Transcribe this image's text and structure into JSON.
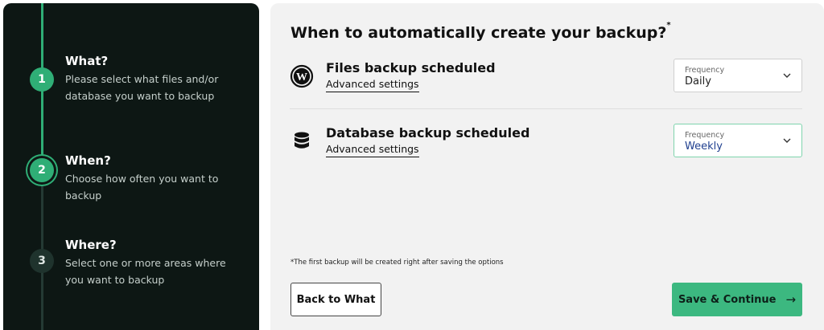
{
  "steps": [
    {
      "number": "1",
      "title": "What?",
      "description": "Please select what files and/or database you want to backup",
      "state": "done"
    },
    {
      "number": "2",
      "title": "When?",
      "description": "Choose how often you want to backup",
      "state": "active"
    },
    {
      "number": "3",
      "title": "Where?",
      "description": "Select one or more areas where you want to backup",
      "state": "todo"
    }
  ],
  "main": {
    "heading": "When to automatically create your backup?",
    "heading_mark": "*",
    "rows": [
      {
        "icon": "wordpress-icon",
        "title": "Files backup scheduled",
        "link": "Advanced settings",
        "frequency_label": "Frequency",
        "frequency_value": "Daily"
      },
      {
        "icon": "database-icon",
        "title": "Database backup scheduled",
        "link": "Advanced settings",
        "frequency_label": "Frequency",
        "frequency_value": "Weekly"
      }
    ],
    "footnote": "*The first backup will be created right after saving the options",
    "back_label": "Back to What",
    "save_label": "Save & Continue",
    "save_arrow": "→"
  },
  "colors": {
    "sidebar_bg": "#0d1714",
    "accent_green": "#3cb880",
    "panel_bg": "#f2f2f2"
  }
}
